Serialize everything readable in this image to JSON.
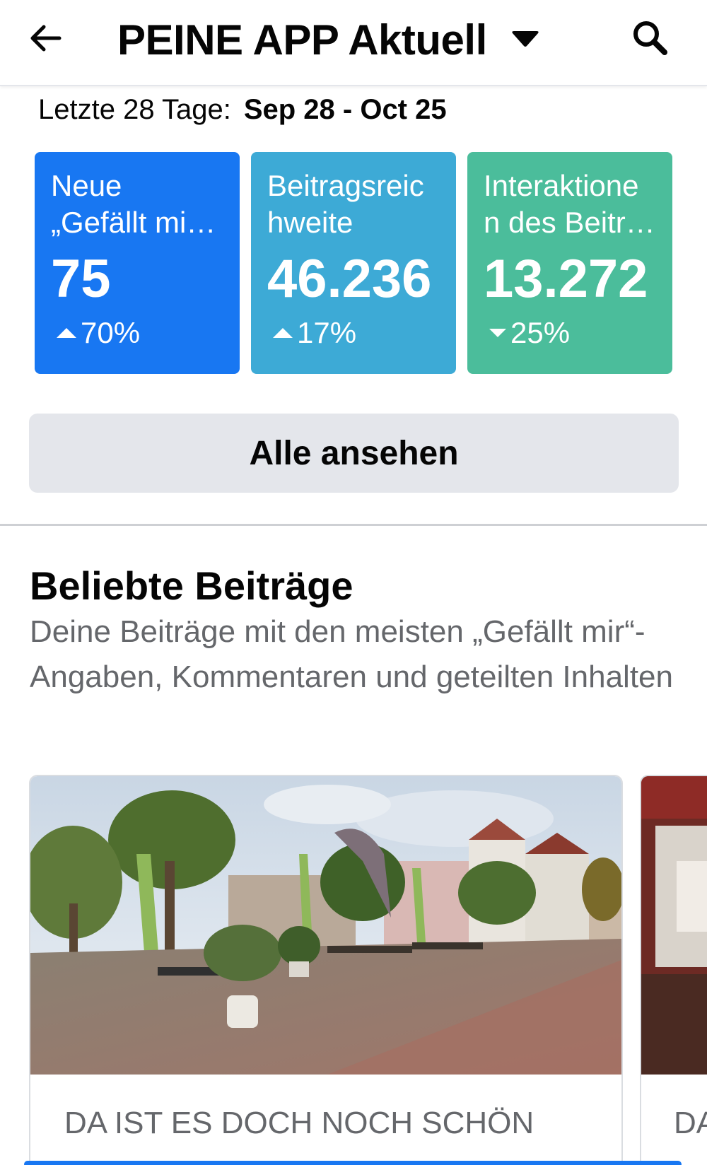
{
  "header": {
    "title": "PEINE APP Aktuell",
    "back_icon": "arrow-left-icon",
    "dropdown_icon": "caret-down-icon",
    "search_icon": "search-icon"
  },
  "date_range": {
    "label": "Letzte 28 Tage:",
    "value": "Sep 28 - Oct 25"
  },
  "metrics": [
    {
      "label": "Neue\n„Gefällt mi…",
      "value": "75",
      "delta": "70%",
      "direction": "up",
      "color": "#1877f2"
    },
    {
      "label": "Beitragsreic\nhweite",
      "value": "46.236",
      "delta": "17%",
      "direction": "up",
      "color": "#3daad6"
    },
    {
      "label": "Interaktione\nn des Beitr…",
      "value": "13.272",
      "delta": "25%",
      "direction": "down",
      "color": "#4bbd9b"
    }
  ],
  "see_all_label": "Alle ansehen",
  "popular": {
    "title": "Beliebte Beiträge",
    "description": "Deine Beiträge mit den meisten „Gefällt mir“-Angaben, Kommentaren und geteilten Inhalten",
    "posts": [
      {
        "caption": "DA IST ES DOCH NOCH SCHÖN"
      },
      {
        "caption": "DA"
      }
    ]
  },
  "colors": {
    "accent": "#1877f2",
    "text_primary": "#050505",
    "text_secondary": "#65676b",
    "button_bg": "#e4e6eb"
  }
}
